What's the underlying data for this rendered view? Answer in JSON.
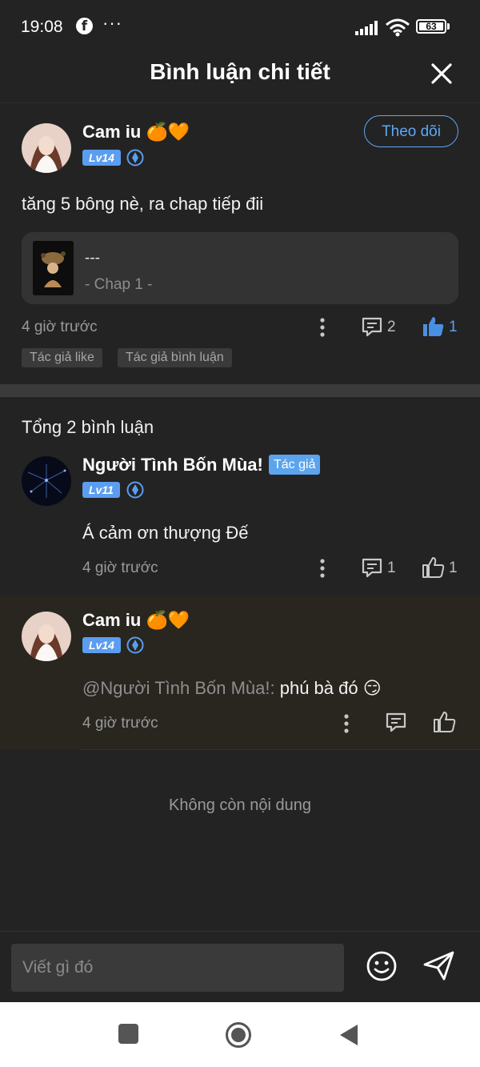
{
  "status_bar": {
    "time": "19:08",
    "app_icon": "facebook-icon",
    "more": "···",
    "battery": "63"
  },
  "header": {
    "title": "Bình luận chi tiết",
    "close_icon": "close-icon"
  },
  "main_comment": {
    "username": "Cam iu 🍊🧡",
    "level": "Lv14",
    "follow_label": "Theo dõi",
    "text": "tăng 5 bông nè, ra chap tiếp đii",
    "chapter": {
      "title": "---",
      "subtitle": "- Chap 1 -"
    },
    "time": "4 giờ trước",
    "reply_count": "2",
    "like_count": "1",
    "liked": true,
    "tags": [
      "Tác giả like",
      "Tác giả bình luận"
    ]
  },
  "replies_header": "Tổng 2 bình luận",
  "replies": [
    {
      "username": "Người Tình Bốn Mùa!",
      "author_tag": "Tác giả",
      "level": "Lv11",
      "text": "Á cảm ơn thượng Đế",
      "time": "4 giờ trước",
      "reply_count": "1",
      "like_count": "1"
    },
    {
      "username": "Cam iu 🍊🧡",
      "level": "Lv14",
      "mention": "@Người Tình Bốn Mùa!:",
      "text": " phú bà đó 😏",
      "time": "4 giờ trước"
    }
  ],
  "no_more_label": "Không còn nội dung",
  "composer": {
    "placeholder": "Viết gì đó",
    "emoji_icon": "emoji-icon",
    "send_icon": "send-icon"
  },
  "colors": {
    "background": "#232323",
    "accent": "#5da8f5",
    "like_active": "#4a90e2",
    "reply_highlight": "#28261f"
  }
}
